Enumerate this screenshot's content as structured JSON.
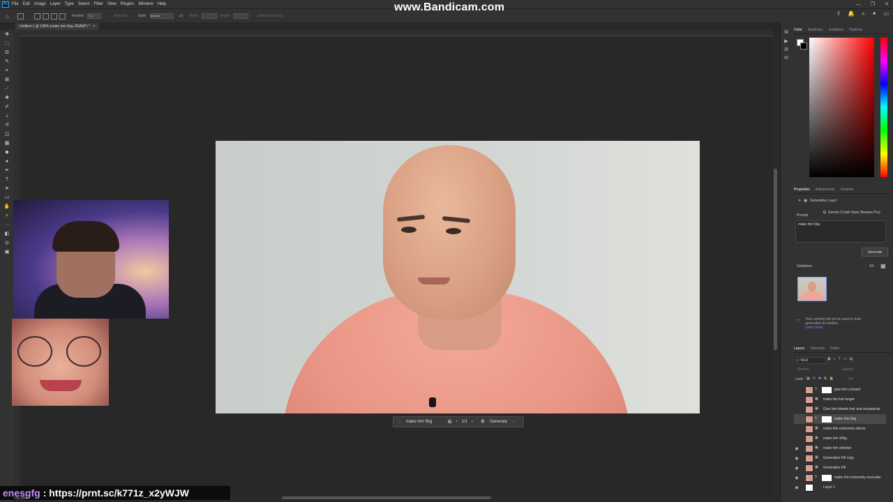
{
  "menubar": {
    "items": [
      "File",
      "Edit",
      "Image",
      "Layer",
      "Type",
      "Select",
      "Filter",
      "View",
      "Plugins",
      "Window",
      "Help"
    ],
    "app_icon": "Ps"
  },
  "watermark": "www.Bandicam.com",
  "options_bar": {
    "feather_label": "Feather:",
    "feather_value": "0 px",
    "antialias_label": "Anti-alias",
    "style_label": "Style:",
    "style_value": "Normal",
    "width_label": "Width:",
    "height_label": "Height:",
    "select_mask_label": "Select and Mask..."
  },
  "document_tab": {
    "title": "Untitled-1 @ 108% (make him 5kg, RGB/8*) *",
    "close": "×"
  },
  "generate_bar": {
    "prompt": "make him 5kg",
    "page": "1/1",
    "generate_label": "Generate",
    "more": "···"
  },
  "overlay": {
    "username": "enesgfg",
    "message": ": https://prnt.sc/k771z_x2yWJW"
  },
  "panels": {
    "color_tabs": [
      "Color",
      "Swatches",
      "Gradients",
      "Patterns"
    ],
    "properties_tabs": [
      "Properties",
      "Adjustments",
      "Libraries"
    ],
    "layer_type": "Generative Layer",
    "model": "Gemini 3 (with Nano Banana Pro)",
    "prompt_label": "Prompt",
    "prompt_value": "make him 5kg",
    "generate_label": "Generate",
    "variations_label": "Variations",
    "variations_count": "1/1",
    "privacy_note": "Your content will not be used to train generative AI models.",
    "learn_more": "Learn more",
    "layers_tabs": [
      "Layers",
      "Channels",
      "Paths"
    ],
    "kind_label": "Kind",
    "blend_mode": "Normal",
    "opacity_label": "Opacity:",
    "lock_label": "Lock:",
    "fill_label": "Fill:"
  },
  "layers": [
    {
      "name": "give him a beard",
      "visible": false,
      "mask": true,
      "selected": false
    },
    {
      "name": "make his hair longer",
      "visible": false,
      "mask": false,
      "selected": false
    },
    {
      "name": "Give him blonde hair and moustache",
      "visible": false,
      "mask": false,
      "selected": false
    },
    {
      "name": "make him 5kg",
      "visible": false,
      "mask": true,
      "selected": true
    },
    {
      "name": "make him extremely skinny",
      "visible": false,
      "mask": false,
      "selected": false
    },
    {
      "name": "make him 40kg",
      "visible": false,
      "mask": false,
      "selected": false
    },
    {
      "name": "make him slimmer",
      "visible": true,
      "mask": false,
      "selected": false
    },
    {
      "name": "Generative Fill copy",
      "visible": true,
      "mask": false,
      "selected": false
    },
    {
      "name": "Generative Fill",
      "visible": true,
      "mask": false,
      "selected": false
    },
    {
      "name": "make him extremely muscular",
      "visible": true,
      "mask": true,
      "selected": false
    },
    {
      "name": "Layer 1",
      "visible": true,
      "mask": false,
      "selected": false
    }
  ],
  "statusbar": {
    "zoom": "108.33%"
  }
}
